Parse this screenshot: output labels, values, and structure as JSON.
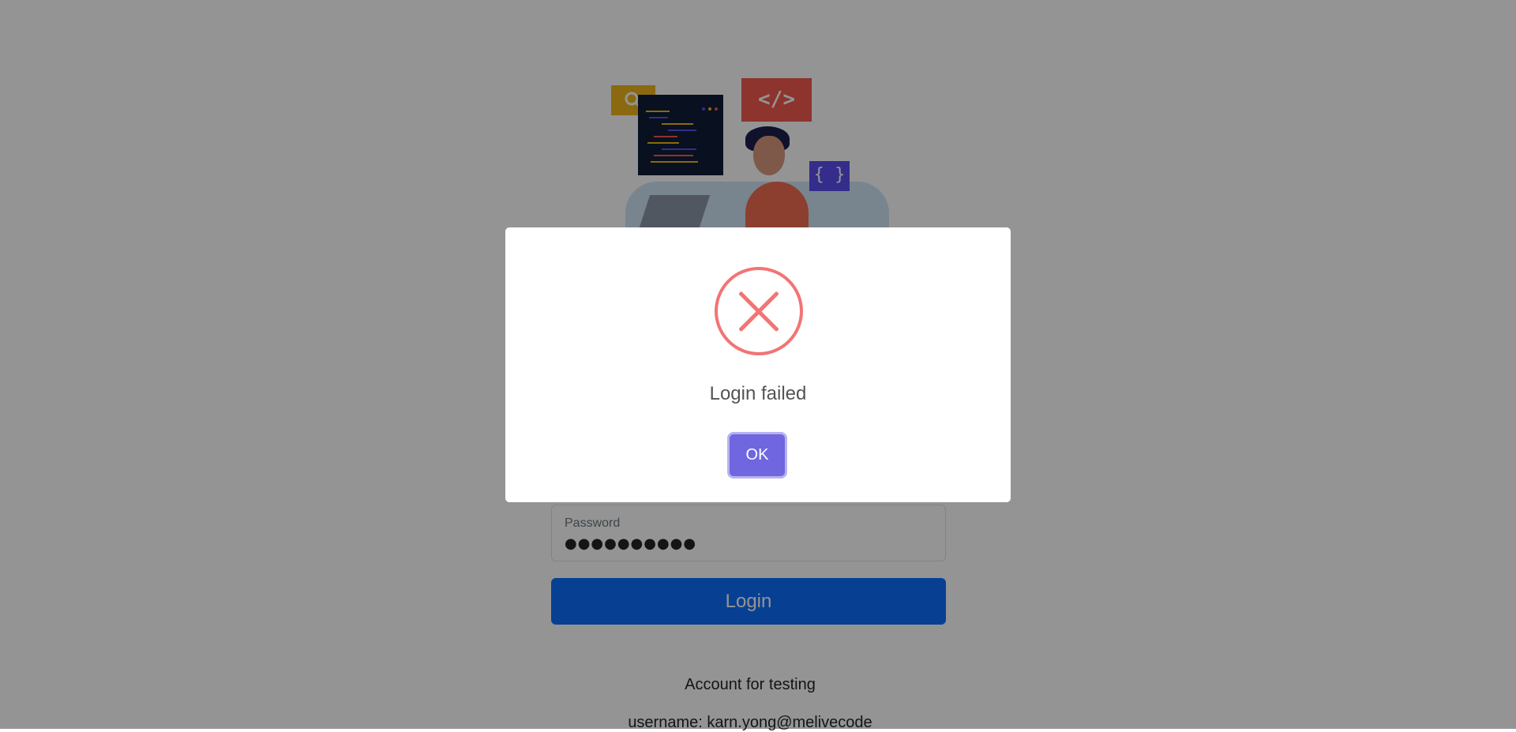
{
  "illustration": {
    "tag_symbol": "</>",
    "braces_symbol": "{ }"
  },
  "login_form": {
    "password_label": "Password",
    "password_value": "●●●●●●●●●●",
    "login_label": "Login"
  },
  "testing_info": {
    "heading": "Account for testing",
    "username_line": "username: karn.yong@melivecode"
  },
  "modal": {
    "title": "Login failed",
    "ok_label": "OK",
    "icon": "error-x-icon"
  },
  "colors": {
    "error": "#f27474",
    "confirm": "#7066e0",
    "primary": "#0d6efd"
  }
}
